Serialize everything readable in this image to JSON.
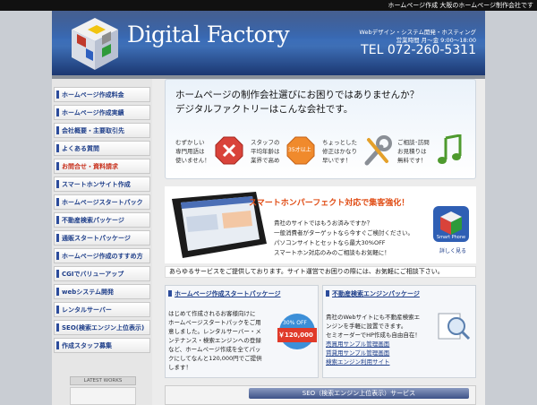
{
  "topbar": {
    "text": "ホームページ作成 大阪のホームページ制作会社です"
  },
  "header": {
    "logo_text": "Digital Factory",
    "sub_line1": "Webデザイン・システム開発・ホスティング",
    "sub_line2": "営業時間 月～金 9:00～18:00",
    "tel": "TEL 072-260-5311"
  },
  "sidebar": {
    "items": [
      {
        "label": "ホームページ作成料金"
      },
      {
        "label": "ホームページ作成実績"
      },
      {
        "label": "会社概要・主要取引先"
      },
      {
        "label": "よくある質問"
      },
      {
        "label": "お問合せ・資料請求"
      },
      {
        "label": "スマートホンサイト作成"
      },
      {
        "label": "ホームページスタートパック"
      },
      {
        "label": "不動産検索パッケージ"
      },
      {
        "label": "通販スタートパッケージ"
      },
      {
        "label": "ホームページ作成のすすめ方"
      },
      {
        "label": "CGIでバリューアップ"
      },
      {
        "label": "webシステム開発"
      },
      {
        "label": "レンタルサーバー"
      },
      {
        "label": "SEO(検索エンジン上位表示)"
      },
      {
        "label": "作成スタッフ募集"
      }
    ],
    "latest_works": "LATEST WORKS"
  },
  "intro": {
    "line1": "ホームページの制作会社選びにお困りではありませんか？",
    "line2": "デジタルファクトリーはこんな会社です。",
    "feature1": [
      "むずかしい",
      "専門用語は",
      "使いません！"
    ],
    "feature2": [
      "スタッフの",
      "平均年齢は",
      "業界で高め"
    ],
    "feature3": [
      "ちょっとした",
      "修正はかなり",
      "早いです！"
    ],
    "feature4": [
      "ご相談･訪問",
      "お見積りは",
      "無料です！"
    ],
    "badge_text": "35才以上"
  },
  "promo": {
    "title": "スマートホンパーフェクト対応で集客強化！",
    "lines": [
      "貴社のサイトではもうお済みですか？",
      "一般消費者がターゲットなら今すぐご検討ください。",
      "パソコンサイトとセットなら最大30%OFF",
      "スマートホン対応のみのご相談もお気軽に！"
    ],
    "button_caption": "Smart Phone",
    "button_label": "詳しく見る"
  },
  "service_bar": {
    "text": "あらゆるサービスをご提供しております。サイト運営でお困りの際には、お気軽にご相談下さい。"
  },
  "columns": {
    "left": {
      "heading": "ホームページ作成スタートパッケージ",
      "lines": [
        "はじめて作成されるお客様向けに",
        "ホームページスタートパックをご用",
        "意しました。レンタルサーバー・メ",
        "ンテナンス・検索エンジンへの登録",
        "など、ホームページ作成を全てパッ",
        "クにしてなんと120,000円でご提供",
        "します！"
      ],
      "badge_top": "30% OFF",
      "badge_price": "￥120,000"
    },
    "right": {
      "heading": "不動産検索エンジンパッケージ",
      "lines": [
        "貴社のWebサイトにも不動産検索エ",
        "ンジンを手軽に設置できます。",
        "セミオーダーでHP作成も自由自在！"
      ],
      "links": [
        "売買用サンプル管理画面",
        "賃貸用サンプル管理画面",
        "検索エンジン利用サイト"
      ]
    }
  },
  "seo": {
    "label": "SEO（検索エンジン上位表示）サービス"
  },
  "colors": {
    "accent": "#1f3f8a",
    "header": "#3b6db8",
    "promo": "#e04c14"
  }
}
